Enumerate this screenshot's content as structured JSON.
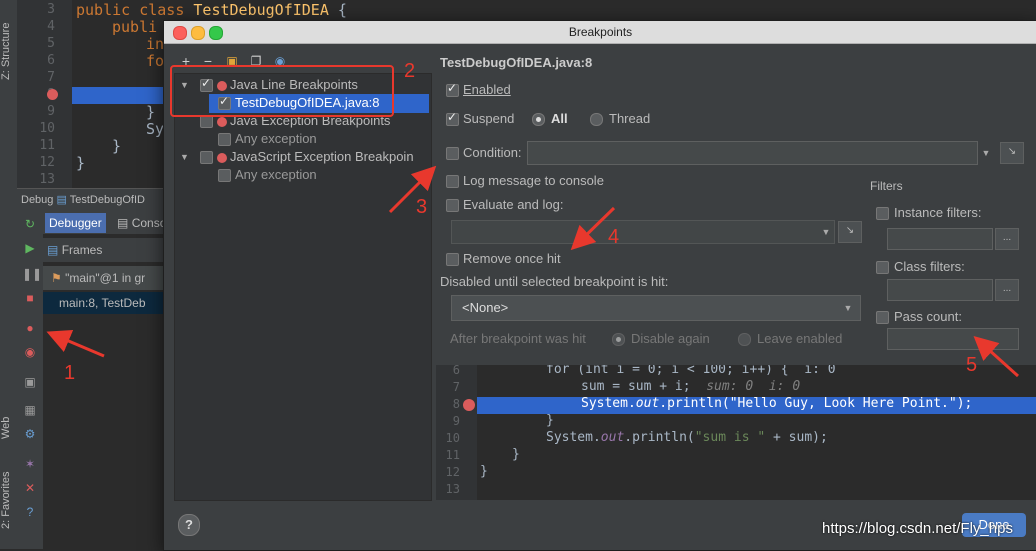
{
  "ide": {
    "left_tabs": [
      "Z: Structure",
      "Web",
      "2: Favorites"
    ],
    "line_numbers": [
      "3",
      "4",
      "5",
      "6",
      "7",
      "8",
      "9",
      "10",
      "11",
      "12",
      "13"
    ],
    "code_lines": {
      "l3_kw": "public class ",
      "l3_cls": "TestDebugOfIDEA",
      "l3_rest": " {",
      "l4": "publi",
      "l5": "in",
      "l6": "fo",
      "l9": "}",
      "l10": "Sy",
      "l11": "}",
      "l12": "}"
    },
    "debug_title": "Debug",
    "debug_config": "TestDebugOfID",
    "tabs": [
      "Debugger",
      "Conso"
    ],
    "frames_label": "Frames",
    "thread_label": "\"main\"@1 in gr",
    "frame_label": "main:8, TestDeb"
  },
  "dialog": {
    "title": "Breakpoints",
    "toolbar": {
      "add": "+",
      "remove": "−"
    },
    "tree": {
      "group1": "Java Line Breakpoints",
      "group1_item": "TestDebugOfIDEA.java:8",
      "group2": "Java Exception Breakpoints",
      "group2_item": "Any exception",
      "group3": "JavaScript Exception Breakpoin",
      "group3_item": "Any exception"
    },
    "detail": {
      "heading": "TestDebugOfIDEA.java:8",
      "enabled": "Enabled",
      "suspend": "Suspend",
      "all": "All",
      "thread": "Thread",
      "condition": "Condition:",
      "log_message": "Log message to console",
      "evaluate_log": "Evaluate and log:",
      "remove_once_hit": "Remove once hit",
      "disabled_until": "Disabled until selected breakpoint is hit:",
      "none_option": "<None>",
      "after_hit": "After breakpoint was hit",
      "disable_again": "Disable again",
      "leave_enabled": "Leave enabled",
      "filters_title": "Filters",
      "instance_filters": "Instance filters:",
      "class_filters": "Class filters:",
      "pass_count": "Pass count:",
      "dots": "..."
    },
    "preview": {
      "lines": [
        "6",
        "7",
        "8",
        "9",
        "10",
        "11",
        "12",
        "13"
      ],
      "l6": "for (int i = 0; i < 100; i++) {  i: 0",
      "l7_code": "sum = sum + i;",
      "l7_hint": "  sum: 0  i: 0",
      "l8_a": "System.",
      "l8_b": "out",
      "l8_c": ".println(",
      "l8_str": "\"Hello Guy, Look Here Point.\"",
      "l8_d": ");",
      "l9": "}",
      "l10_a": "System.",
      "l10_b": "out",
      "l10_c": ".println(",
      "l10_str": "\"sum is \"",
      "l10_d": " + sum);",
      "l11": "}",
      "l12": "}"
    },
    "help": "?",
    "done": "Done"
  },
  "annotations": [
    "1",
    "2",
    "3",
    "4",
    "5"
  ],
  "watermark": "https://blog.csdn.net/Fly_hps",
  "colors": {
    "annotation": "#e8382d",
    "selection": "#2f65ca",
    "breakpoint": "#db5c5c"
  }
}
